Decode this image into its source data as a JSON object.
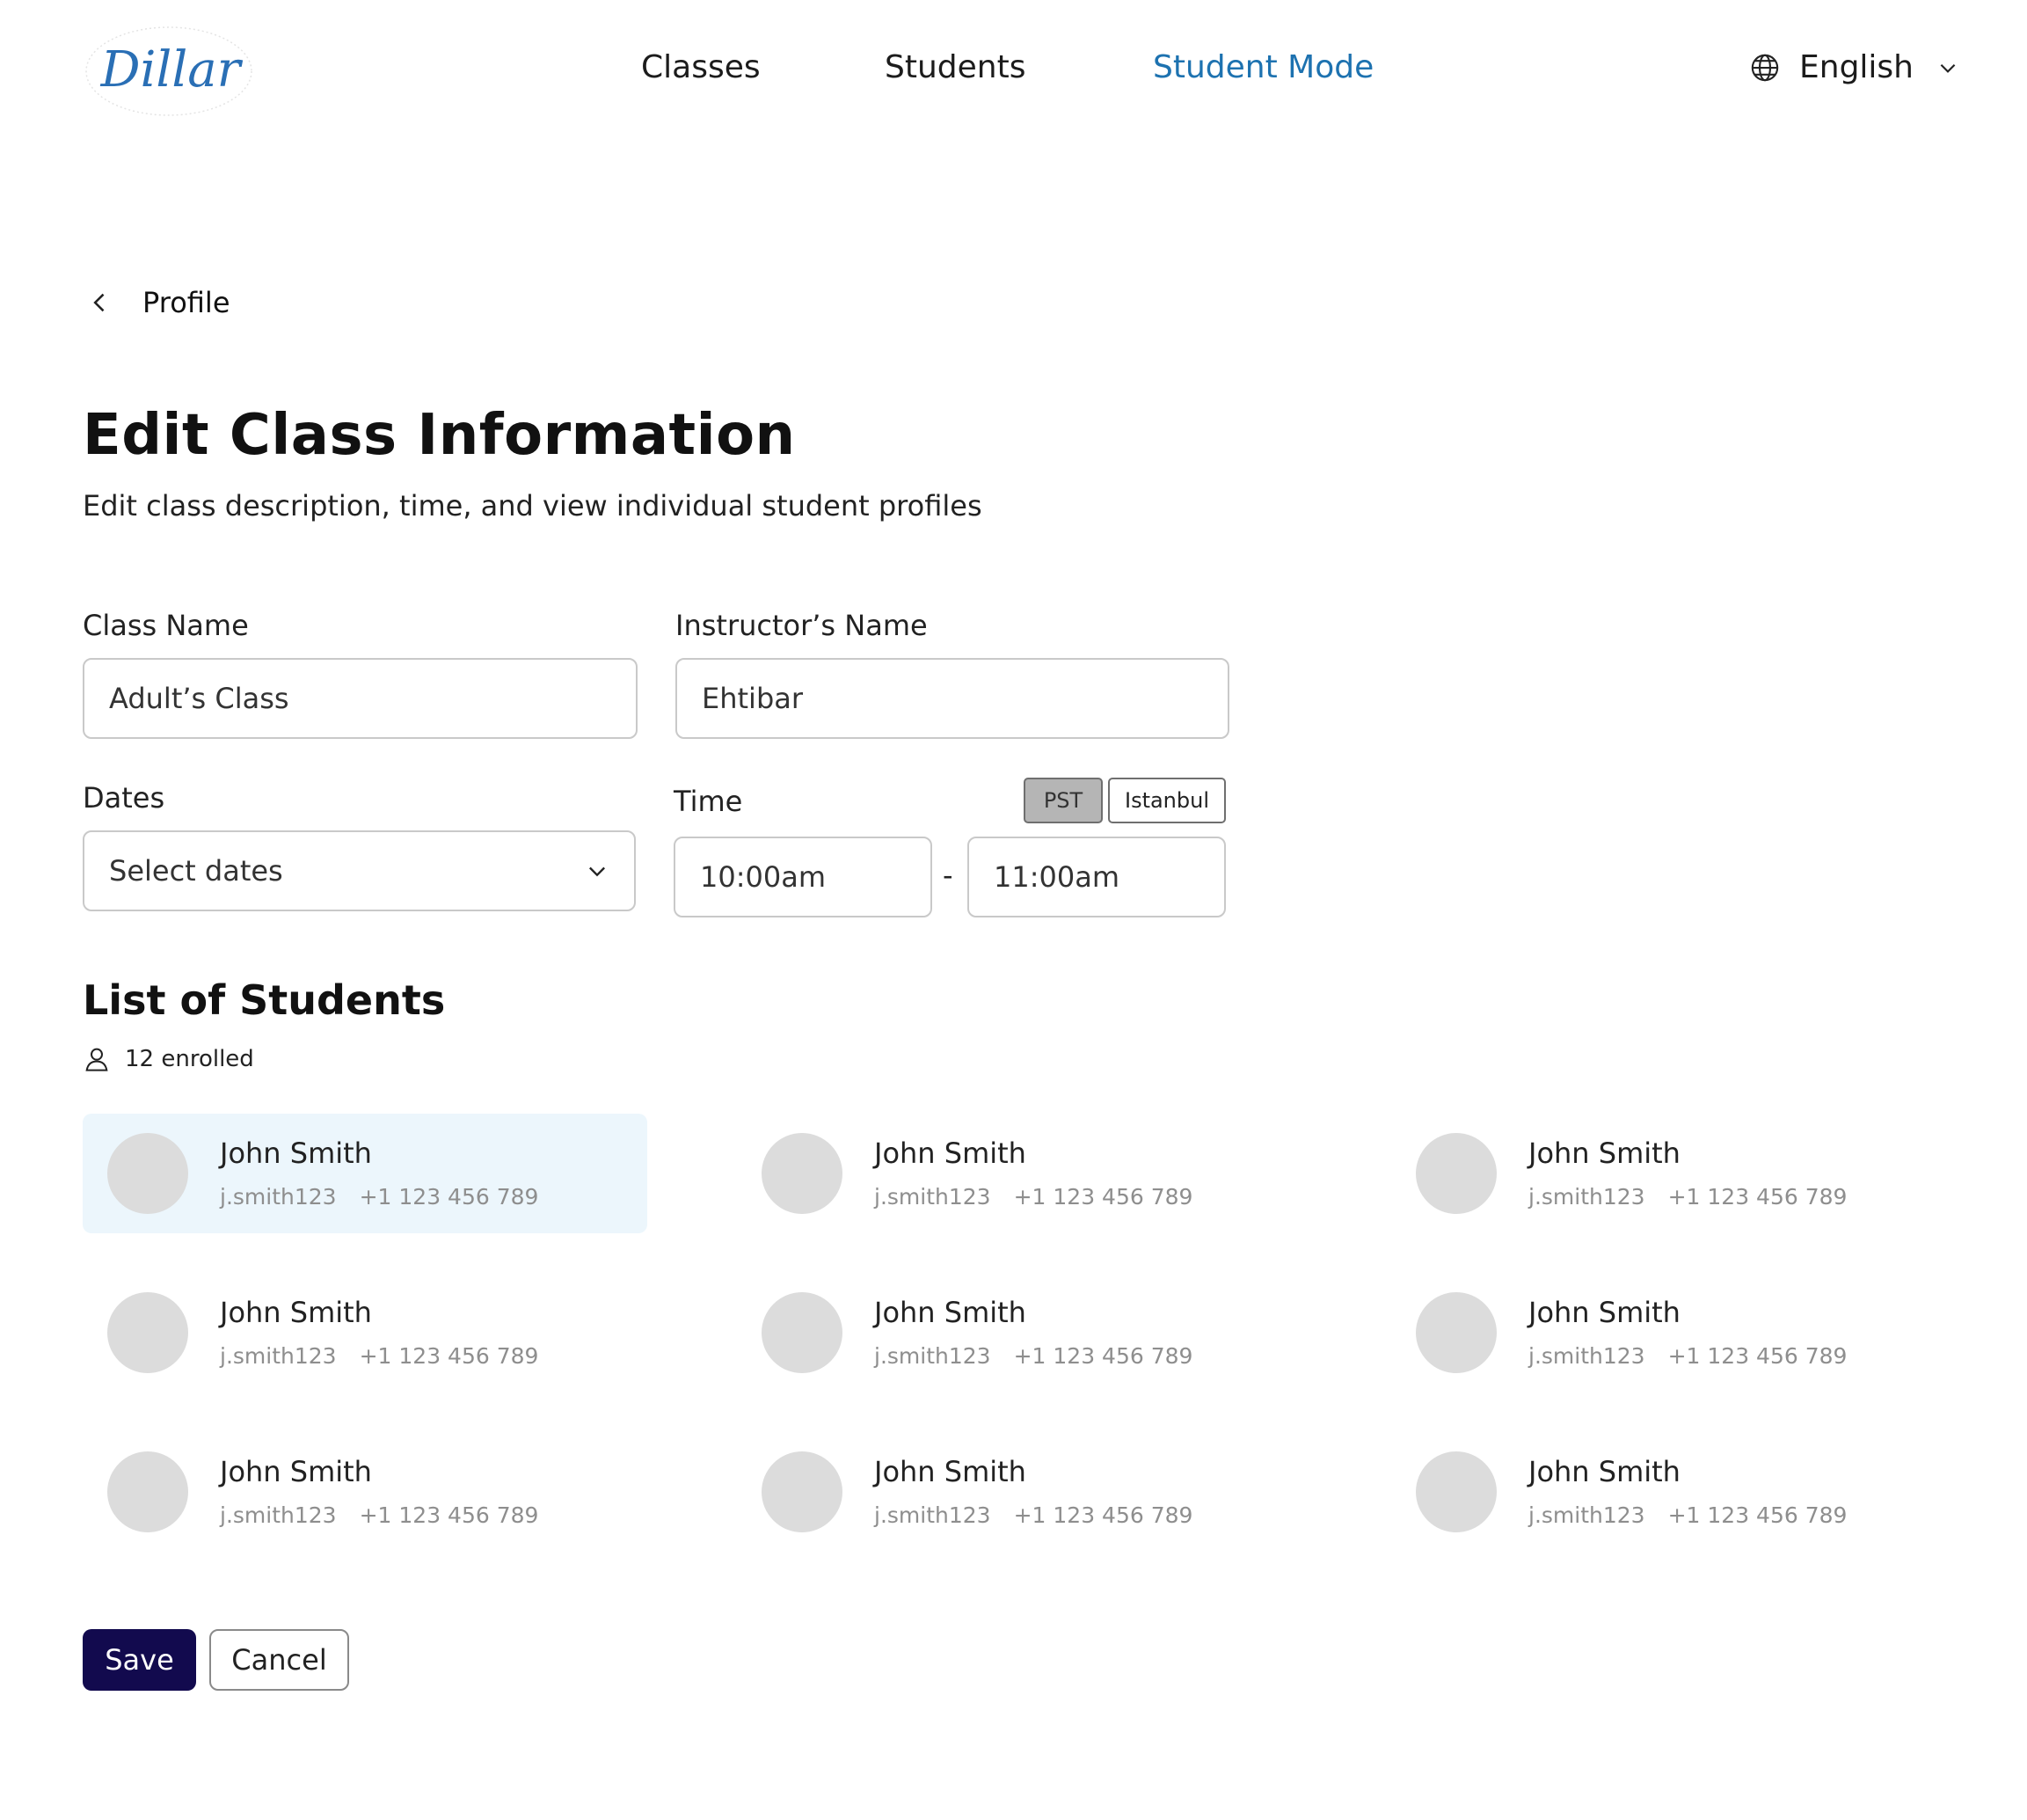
{
  "brand": {
    "logo_text": "Dillar"
  },
  "nav": {
    "items": [
      {
        "label": "Classes",
        "active": false
      },
      {
        "label": "Students",
        "active": false
      },
      {
        "label": "Student Mode",
        "active": true
      }
    ],
    "language": "English"
  },
  "breadcrumb": {
    "label": "Profile"
  },
  "page": {
    "title": "Edit Class Information",
    "subtitle": "Edit class description, time, and view individual student profiles"
  },
  "form": {
    "class_name": {
      "label": "Class Name",
      "value": "Adult’s Class"
    },
    "instructor_name": {
      "label": "Instructor’s Name",
      "value": "Ehtibar"
    },
    "dates": {
      "label": "Dates",
      "placeholder": "Select dates"
    },
    "time": {
      "label": "Time",
      "start": "10:00am",
      "separator": "-",
      "end": "11:00am",
      "timezones": [
        {
          "label": "PST",
          "selected": true
        },
        {
          "label": "Istanbul",
          "selected": false
        }
      ]
    }
  },
  "students": {
    "title": "List of Students",
    "enrolled": "12 enrolled",
    "items": [
      {
        "name": "John Smith",
        "username": "j.smith123",
        "phone": "+1 123 456 789",
        "highlighted": true
      },
      {
        "name": "John Smith",
        "username": "j.smith123",
        "phone": "+1 123 456 789",
        "highlighted": false
      },
      {
        "name": "John Smith",
        "username": "j.smith123",
        "phone": "+1 123 456 789",
        "highlighted": false
      },
      {
        "name": "John Smith",
        "username": "j.smith123",
        "phone": "+1 123 456 789",
        "highlighted": false
      },
      {
        "name": "John Smith",
        "username": "j.smith123",
        "phone": "+1 123 456 789",
        "highlighted": false
      },
      {
        "name": "John Smith",
        "username": "j.smith123",
        "phone": "+1 123 456 789",
        "highlighted": false
      },
      {
        "name": "John Smith",
        "username": "j.smith123",
        "phone": "+1 123 456 789",
        "highlighted": false
      },
      {
        "name": "John Smith",
        "username": "j.smith123",
        "phone": "+1 123 456 789",
        "highlighted": false
      },
      {
        "name": "John Smith",
        "username": "j.smith123",
        "phone": "+1 123 456 789",
        "highlighted": false
      }
    ]
  },
  "actions": {
    "save": "Save",
    "cancel": "Cancel"
  },
  "colors": {
    "accent": "#1d72b0",
    "primary_button": "#120a4e",
    "highlight_card": "#ecf6fc",
    "avatar_placeholder": "#dcdcdc"
  }
}
